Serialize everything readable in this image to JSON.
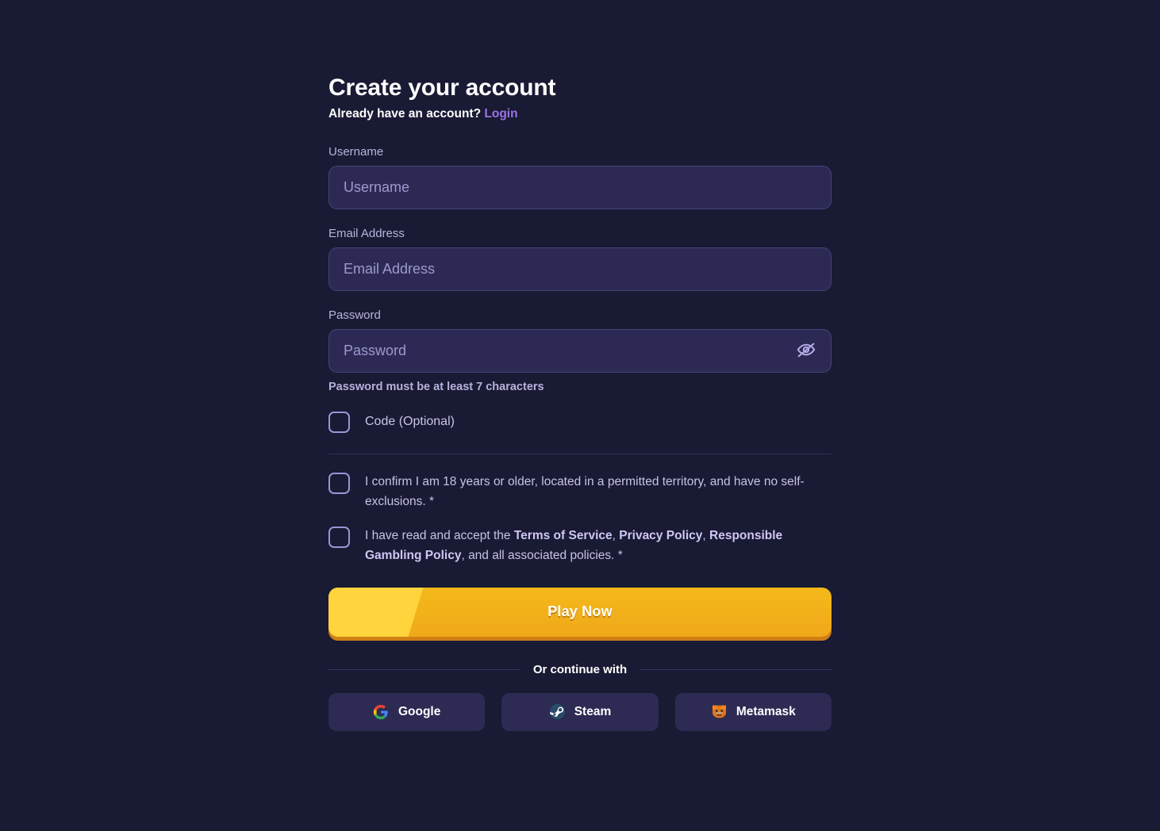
{
  "heading": {
    "title": "Create your account",
    "subtitle_prefix": "Already have an account?",
    "login_label": "Login"
  },
  "fields": {
    "username": {
      "label": "Username",
      "placeholder": "Username",
      "value": ""
    },
    "email": {
      "label": "Email Address",
      "placeholder": "Email Address",
      "value": ""
    },
    "password": {
      "label": "Password",
      "placeholder": "Password",
      "value": "",
      "helper": "Password must be at least 7 characters",
      "toggle_icon": "eye-off-icon"
    }
  },
  "code_option": {
    "label": "Code (Optional)",
    "checked": false
  },
  "consents": [
    {
      "id": "age-confirmation",
      "checked": false,
      "text_parts": [
        {
          "type": "text",
          "value": "I confirm I am 18 years or older, located in a permitted territory, and have no self-exclusions. *"
        }
      ]
    },
    {
      "id": "terms-acceptance",
      "checked": false,
      "text_parts": [
        {
          "type": "text",
          "value": "I have read and accept the "
        },
        {
          "type": "link",
          "value": "Terms of Service"
        },
        {
          "type": "text",
          "value": ", "
        },
        {
          "type": "link",
          "value": "Privacy Policy"
        },
        {
          "type": "text",
          "value": ", "
        },
        {
          "type": "link",
          "value": "Responsible Gambling Policy"
        },
        {
          "type": "text",
          "value": ", and all associated policies. *"
        }
      ]
    }
  ],
  "submit": {
    "label": "Play Now"
  },
  "social": {
    "divider_label": "Or continue with",
    "providers": [
      {
        "label": "Google",
        "icon": "google-icon"
      },
      {
        "label": "Steam",
        "icon": "steam-icon"
      },
      {
        "label": "Metamask",
        "icon": "metamask-icon"
      }
    ]
  },
  "colors": {
    "page_bg": "#191a33",
    "input_bg": "#2c2a55",
    "input_border": "#474279",
    "accent_link": "#9a74e8",
    "cta_yellow": "#f5b91b",
    "cta_shadow": "#cf7f15",
    "checkbox_border": "#9b94d8"
  }
}
